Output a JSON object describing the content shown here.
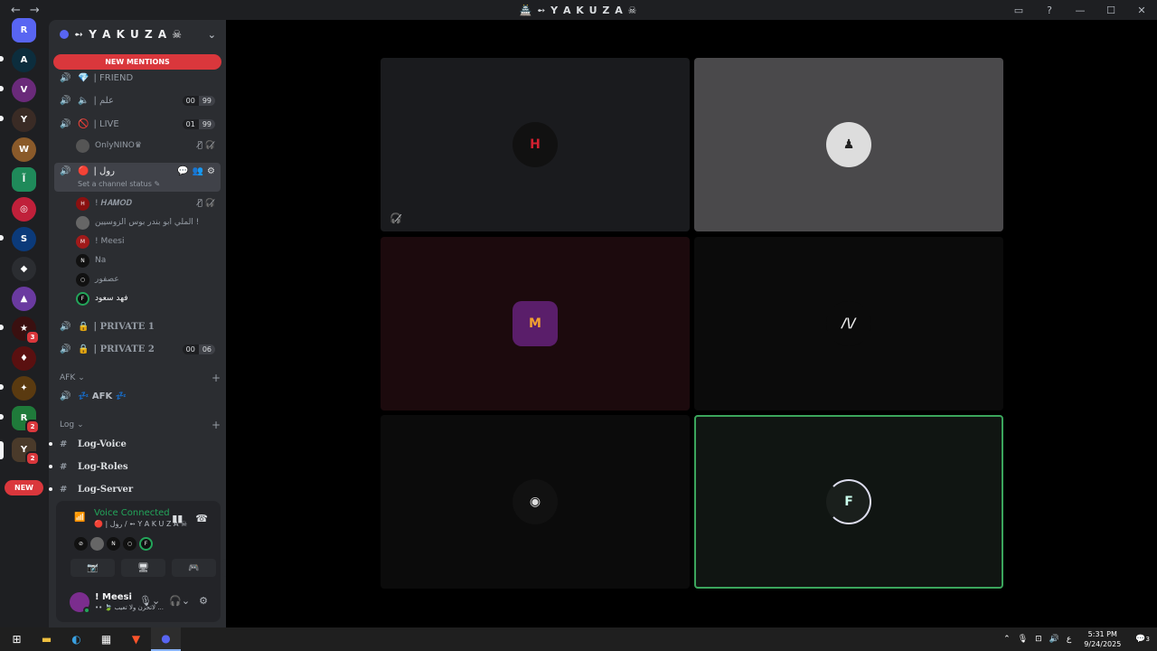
{
  "window": {
    "title": "🏯 ➻ Y A K U Z A ☠︎",
    "back": "←",
    "forward": "→",
    "controls": [
      "▭",
      "?",
      "—",
      "☐",
      "✕"
    ]
  },
  "guild_bar": {
    "new_label": "NEW",
    "badges": [
      "3",
      "2",
      "2"
    ]
  },
  "server": {
    "name": "➻ Y A K U Z A ☠︎",
    "new_mentions": "NEW MENTIONS"
  },
  "channels": [
    {
      "emoji": "💎",
      "name": "| FRIEND"
    },
    {
      "emoji": "🔈",
      "name": "| علم",
      "count_a": "00",
      "count_b": "99"
    },
    {
      "emoji": "🚫",
      "name": "| LIVE",
      "count_a": "01",
      "count_b": "99"
    }
  ],
  "live_members": [
    {
      "name": "OnlyNINO♛"
    }
  ],
  "active_channel": {
    "emoji": "🔴",
    "name": "| رول",
    "status": "Set a channel status ✎"
  },
  "active_members": [
    {
      "name": "! 𝑯𝑨𝑴𝑶𝑫"
    },
    {
      "name": "الملي ابو بندر بوس الزوسيين !"
    },
    {
      "name": "! Meesi"
    },
    {
      "name": "Na"
    },
    {
      "name": "عصفور"
    },
    {
      "name": "فهد سعود"
    }
  ],
  "private_channels": [
    {
      "name": "| PRIVATE 1"
    },
    {
      "name": "| PRIVATE 2",
      "count_a": "00",
      "count_b": "06"
    }
  ],
  "categories": {
    "afk": "AFK",
    "afk_channel": "💤 AFK 💤",
    "log": "Log"
  },
  "log_channels": [
    "Log-Voice",
    "Log-Roles",
    "Log-Server"
  ],
  "voice": {
    "connected_label": "Voice Connected",
    "location": "🔴 | رول / ➻ Y A K U Z A ☠︎"
  },
  "user": {
    "name": "! Meesi",
    "status": "•• 🍃 لاتحزن ولا تعيب ..."
  },
  "taskbar": {
    "time": "5:31 PM",
    "date": "9/24/2025",
    "lang": "ع",
    "notif_count": "3"
  }
}
